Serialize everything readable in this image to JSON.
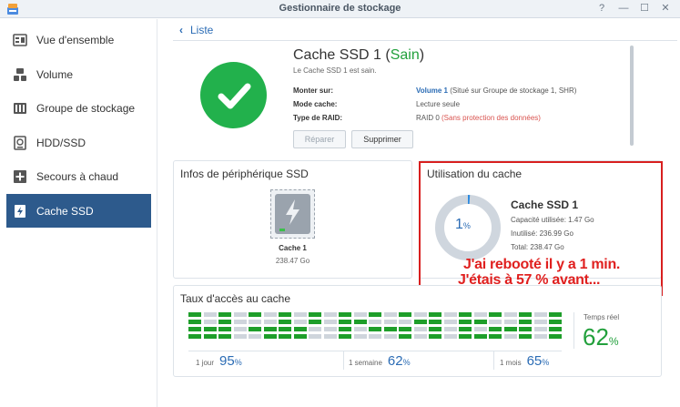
{
  "window": {
    "title": "Gestionnaire de stockage",
    "buttons": [
      "?",
      "—",
      "☐",
      "✕"
    ]
  },
  "sidebar": {
    "items": [
      {
        "label": "Vue d'ensemble",
        "icon": "overview-icon"
      },
      {
        "label": "Volume",
        "icon": "volume-icon"
      },
      {
        "label": "Groupe de stockage",
        "icon": "storage-pool-icon"
      },
      {
        "label": "HDD/SSD",
        "icon": "hdd-icon"
      },
      {
        "label": "Secours à chaud",
        "icon": "hot-spare-icon"
      },
      {
        "label": "Cache SSD",
        "icon": "ssd-cache-icon",
        "active": true
      }
    ]
  },
  "nav": {
    "back_label": "Liste"
  },
  "cache": {
    "name": "Cache SSD 1",
    "status_open": " (",
    "status": "Sain",
    "status_close": ")",
    "subtitle": "Le Cache SSD 1 est sain.",
    "fields": [
      {
        "key": "Monter sur:",
        "link": "Volume 1",
        "value": " (Situé sur Groupe de stockage 1, SHR)"
      },
      {
        "key": "Mode cache:",
        "value": "Lecture seule"
      },
      {
        "key": "Type de RAID:",
        "value": "RAID 0 ",
        "warning": "(Sans protection des données)"
      }
    ],
    "repair_label": "Réparer",
    "delete_label": "Supprimer"
  },
  "device_info": {
    "title": "Infos de périphérique SSD",
    "device_name": "Cache 1",
    "device_size": "238.47 Go"
  },
  "usage": {
    "title": "Utilisation du cache",
    "percent": "1",
    "percent_unit": "%",
    "percent_value": 0.01,
    "name": "Cache SSD 1",
    "used": "Capacité utilisée: 1.47 Go",
    "unused": "Inutilisé: 236.99 Go",
    "total": "Total: 238.47 Go"
  },
  "annotation": {
    "line1": "J'ai rebooté il y a 1 min.",
    "line2": "J'étais à 57 % avant..."
  },
  "hit_rate": {
    "title": "Taux d'accès au cache",
    "realtime_label": "Temps réel",
    "realtime_value": "62",
    "unit": "%",
    "stats": [
      {
        "label": "1 jour",
        "value": "95"
      },
      {
        "label": "1 semaine",
        "value": "62"
      },
      {
        "label": "1 mois",
        "value": "65"
      }
    ],
    "columns": [
      [
        1,
        1,
        1,
        1
      ],
      [
        0,
        0,
        1,
        1
      ],
      [
        1,
        1,
        1,
        1
      ],
      [
        0,
        0,
        0,
        0
      ],
      [
        1,
        0,
        1,
        0
      ],
      [
        0,
        0,
        1,
        1
      ],
      [
        1,
        1,
        1,
        1
      ],
      [
        0,
        0,
        1,
        1
      ],
      [
        1,
        1,
        0,
        0
      ],
      [
        0,
        0,
        0,
        0
      ],
      [
        1,
        1,
        1,
        1
      ],
      [
        0,
        1,
        0,
        0
      ],
      [
        1,
        0,
        1,
        0
      ],
      [
        0,
        0,
        1,
        0
      ],
      [
        1,
        0,
        1,
        1
      ],
      [
        0,
        1,
        0,
        0
      ],
      [
        1,
        1,
        1,
        1
      ],
      [
        0,
        0,
        0,
        0
      ],
      [
        1,
        1,
        1,
        1
      ],
      [
        0,
        1,
        0,
        1
      ],
      [
        1,
        0,
        1,
        1
      ],
      [
        0,
        0,
        1,
        0
      ],
      [
        1,
        1,
        1,
        1
      ],
      [
        0,
        0,
        0,
        0
      ],
      [
        1,
        1,
        1,
        1
      ]
    ],
    "colors": {
      "hit": "#1e9e2a",
      "miss": "#cfd5dc"
    }
  }
}
